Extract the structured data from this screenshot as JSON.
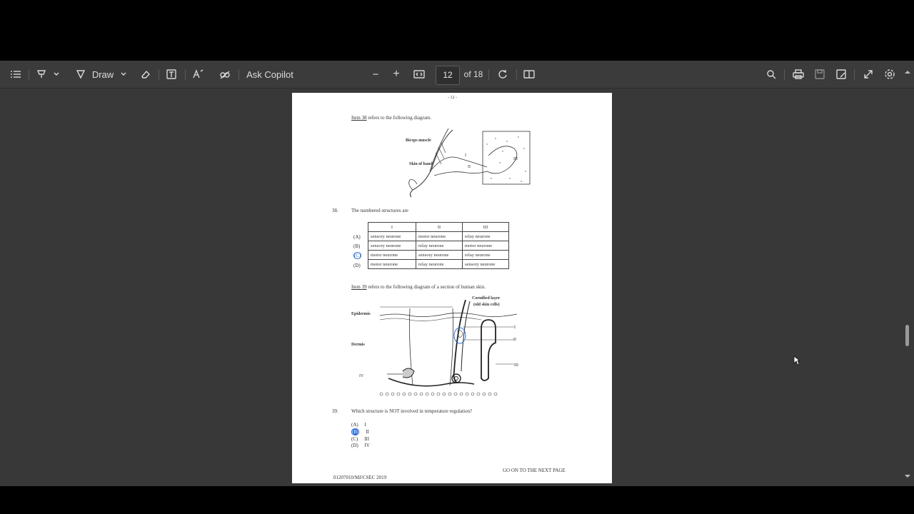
{
  "toolbar": {
    "draw_label": "Draw",
    "ask_copilot_label": "Ask Copilot",
    "zoom_out": "−",
    "zoom_in": "+",
    "page_current": "12",
    "page_total": "of 18"
  },
  "document": {
    "page_marker": "- 12 -",
    "item38_ref": "Item 38",
    "item38_ref_rest": "refers to the following diagram.",
    "diagram38_labels": {
      "biceps": "Biceps muscle",
      "skin": "Skin of hand",
      "i": "I",
      "ii": "II",
      "iii": "III"
    },
    "q38_number": "38.",
    "q38_text": "The numbered structures are",
    "q38_table": {
      "headers": [
        "I",
        "II",
        "III"
      ],
      "rows": [
        {
          "letter": "(A)",
          "cells": [
            "sensory neurone",
            "motor neurone",
            "relay neurone"
          ]
        },
        {
          "letter": "(B)",
          "cells": [
            "sensory neurone",
            "relay neurone",
            "motor neurone"
          ]
        },
        {
          "letter": "(C)",
          "cells": [
            "motor neurone",
            "sensory neurone",
            "relay neurone"
          ]
        },
        {
          "letter": "(D)",
          "cells": [
            "motor neurone",
            "relay neurone",
            "sensory neurone"
          ]
        }
      ]
    },
    "item39_ref": "Item 39",
    "item39_ref_rest": "refers to the following diagram of a section of human skin.",
    "diagram39_labels": {
      "cornified": "Cornified layer",
      "cornified2": "(old skin cells)",
      "epidermis": "Epidermis",
      "dermis": "Dermis",
      "i": "I",
      "ii": "II",
      "iii": "III",
      "iv": "IV"
    },
    "q39_number": "39.",
    "q39_text": "Which structure is NOT involved in temperature regulation?",
    "q39_options": [
      {
        "letter": "(A)",
        "text": "I"
      },
      {
        "letter": "(B)",
        "text": "II"
      },
      {
        "letter": "(C)",
        "text": "III"
      },
      {
        "letter": "(D)",
        "text": "IV"
      }
    ],
    "footer_next": "GO ON TO THE NEXT PAGE",
    "footer_code": "01207010/MJ/CSEC 2019"
  }
}
